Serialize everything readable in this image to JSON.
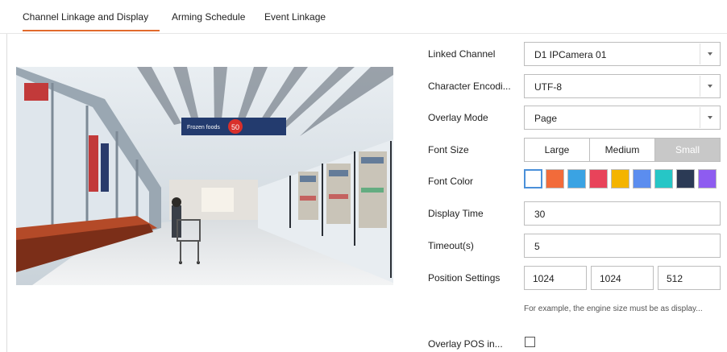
{
  "tabs": [
    {
      "label": "Channel Linkage and Display",
      "active": true
    },
    {
      "label": "Arming Schedule",
      "active": false
    },
    {
      "label": "Event Linkage",
      "active": false
    }
  ],
  "preview": {
    "store_sign_text": "Frozen foods",
    "store_sign_badge": "50"
  },
  "form": {
    "linked_channel": {
      "label": "Linked Channel",
      "value": "D1 IPCamera 01"
    },
    "character_encoding": {
      "label": "Character Encodi...",
      "value": "UTF-8"
    },
    "overlay_mode": {
      "label": "Overlay Mode",
      "value": "Page"
    },
    "font_size": {
      "label": "Font Size",
      "options": [
        "Large",
        "Medium",
        "Small"
      ],
      "selected": "Small"
    },
    "font_color": {
      "label": "Font Color",
      "swatches": [
        "#ffffff",
        "#f26b3a",
        "#3aa3e3",
        "#e8435a",
        "#f4b400",
        "#5b8def",
        "#26c6c6",
        "#2b3a55",
        "#8e5cf0"
      ],
      "selected_index": 0
    },
    "display_time": {
      "label": "Display Time",
      "value": "30"
    },
    "timeout": {
      "label": "Timeout(s)",
      "value": "5"
    },
    "position_settings": {
      "label": "Position Settings",
      "values": [
        "1024",
        "1024",
        "512"
      ]
    },
    "hint": "For example, the engine size must be as display...",
    "overlay_pos": {
      "label": "Overlay POS in..."
    }
  },
  "colors": {
    "accent": "#e26a2c",
    "segment_active": "#c8c8c8"
  }
}
